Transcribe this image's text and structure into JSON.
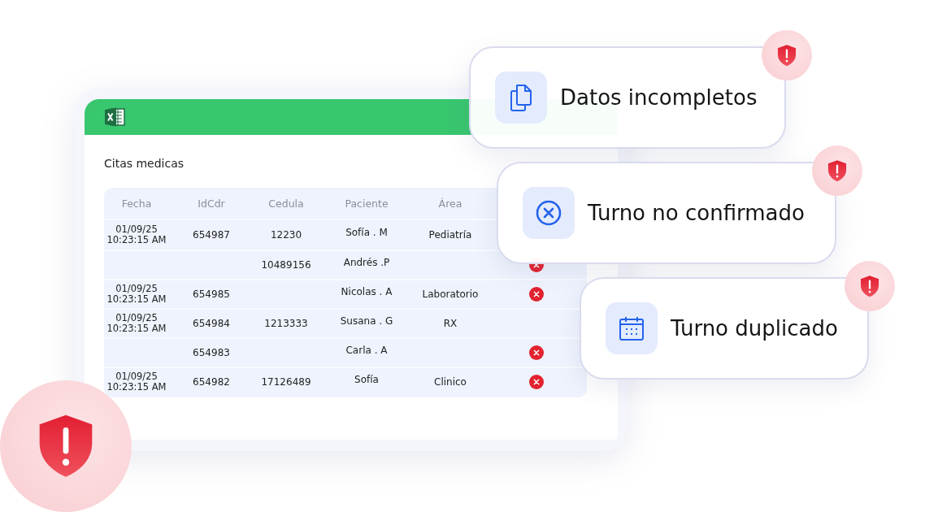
{
  "sheet": {
    "title": "Citas medicas",
    "columns": [
      "Fecha",
      "IdCdr",
      "Cedula",
      "Paciente",
      "Área"
    ],
    "rows": [
      {
        "date": "01/09/25",
        "time": "10:23:15 AM",
        "idcdr": "654987",
        "cedula": "12230",
        "paciente": "Sofía . M",
        "area": "Pediatría",
        "error": false
      },
      {
        "cedula": "10489156",
        "paciente": "Andrés .P",
        "error": true
      },
      {
        "date": "01/09/25",
        "time": "10:23:15 AM",
        "idcdr": "654985",
        "paciente": "Nicolas . A",
        "area": "Laboratorio",
        "error": true
      },
      {
        "date": "01/09/25",
        "time": "10:23:15 AM",
        "idcdr": "654984",
        "cedula": "1213333",
        "paciente": "Susana . G",
        "area": "RX",
        "error": false
      },
      {
        "idcdr": "654983",
        "paciente": "Carla . A",
        "error": true
      },
      {
        "date": "01/09/25",
        "time": "10:23:15 AM",
        "idcdr": "654982",
        "cedula": "17126489",
        "paciente": "Sofía",
        "area": "Clinico",
        "error": true
      }
    ]
  },
  "alerts": [
    {
      "kind": "documents",
      "label": "Datos incompletos"
    },
    {
      "kind": "cancel",
      "label": "Turno no confirmado"
    },
    {
      "kind": "calendar",
      "label": "Turno duplicado"
    }
  ]
}
